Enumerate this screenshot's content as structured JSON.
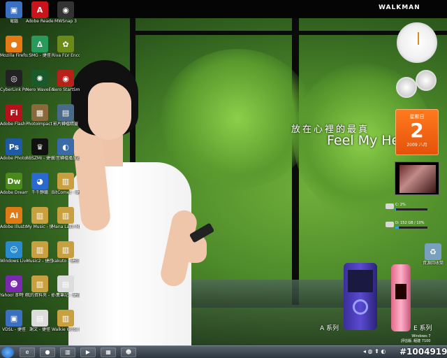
{
  "desktop_icons": [
    {
      "label": "電腦",
      "glyph": "▣",
      "color": "#3a6fc2"
    },
    {
      "label": "Adobe Reader 9",
      "glyph": "A",
      "color": "#c8141a"
    },
    {
      "label": "MWSnap 3",
      "glyph": "◉",
      "color": "#333333"
    },
    {
      "label": "Mozilla Firefox",
      "glyph": "●",
      "color": "#e57a14"
    },
    {
      "label": "SMG - 捷徑",
      "glyph": "∆",
      "color": "#2a9a5a"
    },
    {
      "label": "Riva FLV Encoder",
      "glyph": "✿",
      "color": "#6a8a1a"
    },
    {
      "label": "CyberLink PowerDVD 9",
      "glyph": "◎",
      "color": "#222222"
    },
    {
      "label": "Nero WaveEditor",
      "glyph": "✺",
      "color": "#1a5a2a"
    },
    {
      "label": "Nero StartSmart",
      "glyph": "◉",
      "color": "#b8201a"
    },
    {
      "label": "Adobe Flash CS3 Profess...",
      "glyph": "Fl",
      "color": "#b5121b"
    },
    {
      "label": "PhotoImpact X3",
      "glyph": "▦",
      "color": "#8a6a3a"
    },
    {
      "label": "影片轉檔精靈",
      "glyph": "▤",
      "color": "#4a6a8a"
    },
    {
      "label": "Adobe Photosho...",
      "glyph": "Ps",
      "color": "#1f5aa6"
    },
    {
      "label": "BBSZMI - 捷徑",
      "glyph": "♛",
      "color": "#111111"
    },
    {
      "label": "影音轉檔播放器",
      "glyph": "◐",
      "color": "#3a6aa8"
    },
    {
      "label": "Adobe Dreamwea...",
      "glyph": "Dw",
      "color": "#4a8a1a"
    },
    {
      "label": "千千靜聽",
      "glyph": "◕",
      "color": "#2a6ad0"
    },
    {
      "label": "BitComet - 捷徑",
      "glyph": "▥",
      "color": "#c8a040"
    },
    {
      "label": "Adobe Illustrat...",
      "glyph": "Ai",
      "color": "#e07a14"
    },
    {
      "label": "My Music - 捷徑",
      "glyph": "▥",
      "color": "#c8a040"
    },
    {
      "label": "Mana Lalin My Way 2008",
      "glyph": "▥",
      "color": "#c8a040"
    },
    {
      "label": "Windows Live Messenger",
      "glyph": "☺",
      "color": "#2a8ad0"
    },
    {
      "label": "Music2 - 捷徑",
      "glyph": "▥",
      "color": "#c8a040"
    },
    {
      "label": "kakuto - 捷徑",
      "glyph": "▥",
      "color": "#c8a040"
    },
    {
      "label": "Yahoo! 即時 Messenger",
      "glyph": "☻",
      "color": "#7a2ab0"
    },
    {
      "label": "我的資料夾 - 捷徑",
      "glyph": "▥",
      "color": "#c8a040"
    },
    {
      "label": "小薰筆記 - 捷徑",
      "glyph": "▤",
      "color": "#dddddd"
    },
    {
      "label": "VDSL - 捷徑",
      "glyph": "▣",
      "color": "#3a6fc2"
    },
    {
      "label": "謝文 - 捷徑",
      "glyph": "▤",
      "color": "#dddddd"
    },
    {
      "label": "Walkie Write Demo #1",
      "glyph": "▥",
      "color": "#c8a040"
    }
  ],
  "wallpaper": {
    "brand": "WALKMAN",
    "slogan_cn": "放在心裡的最真",
    "slogan_en": "Feel My He",
    "series_a": "A 系列",
    "series_e": "E 系列"
  },
  "gadgets": {
    "calendar": {
      "weekday": "星期日",
      "day": "2",
      "year_month": "2009 八月"
    },
    "drives": [
      {
        "text": "C: 2%",
        "used": 0.02
      },
      {
        "text": "D: 152 GB / 10%",
        "used": 0.1
      }
    ]
  },
  "recycle_bin": {
    "label": "資源回收筒",
    "glyph": "♻",
    "color": "#7aa0c0"
  },
  "os_watermark": {
    "line1": "Windows 7",
    "line2": "評估版. 組建 7100"
  },
  "watermark": "#1004919",
  "taskbar": {
    "buttons": [
      {
        "name": "ie",
        "glyph": "e"
      },
      {
        "name": "firefox",
        "glyph": "●"
      },
      {
        "name": "explorer",
        "glyph": "▥"
      },
      {
        "name": "media",
        "glyph": "▶"
      },
      {
        "name": "photo",
        "glyph": "▦"
      },
      {
        "name": "messenger",
        "glyph": "☻"
      }
    ],
    "tray": "◂ ◍ ⬆ ◐"
  }
}
